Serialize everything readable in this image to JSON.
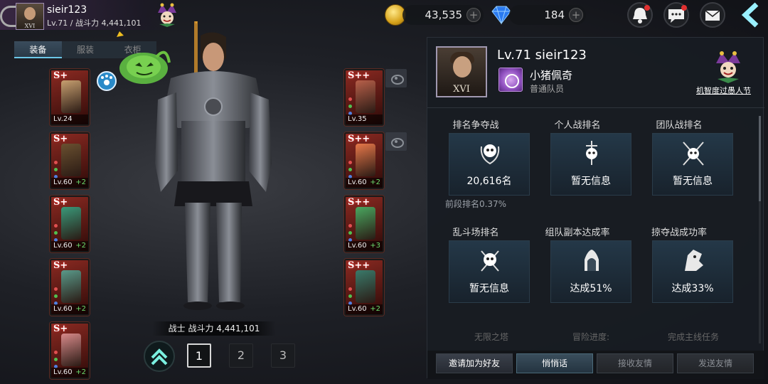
{
  "player": {
    "name": "sieir123",
    "level_line": "Lv.71 / 战斗力 4,441,101",
    "avatar_rank": "XVI"
  },
  "tabs": [
    {
      "label": "装备"
    },
    {
      "label": "服装"
    },
    {
      "label": "衣柜"
    }
  ],
  "active_tab": "装备",
  "left_slots": [
    {
      "grade": "S+",
      "level": "Lv.24",
      "plus": "",
      "art_color": "#c8a070"
    },
    {
      "grade": "S+",
      "level": "Lv.60",
      "plus": "+2",
      "art_color": "#6a5030"
    },
    {
      "grade": "S+",
      "level": "Lv.60",
      "plus": "+2",
      "art_color": "#3a9a7a"
    },
    {
      "grade": "S+",
      "level": "Lv.60",
      "plus": "+2",
      "art_color": "#5a9a8a"
    },
    {
      "grade": "S+",
      "level": "Lv.60",
      "plus": "+2",
      "art_color": "#d88a8a"
    }
  ],
  "right_slots": [
    {
      "grade": "S++",
      "level": "Lv.35",
      "plus": "",
      "art_color": "#b8604a"
    },
    {
      "grade": "S++",
      "level": "Lv.60",
      "plus": "+2",
      "art_color": "#e8784a"
    },
    {
      "grade": "S++",
      "level": "Lv.60",
      "plus": "+3",
      "art_color": "#4aa860"
    },
    {
      "grade": "S++",
      "level": "Lv.60",
      "plus": "+2",
      "art_color": "#3a7a6a"
    }
  ],
  "character": {
    "power_line": "战士 战斗力 4,441,101"
  },
  "pages": [
    "1",
    "2",
    "3"
  ],
  "active_page": "1",
  "currency": {
    "gold": "43,535",
    "gems": "184"
  },
  "profile": {
    "title": "Lv.71 sieir123",
    "guild_name": "小猪佩奇",
    "guild_role": "普通队员",
    "avatar_rank": "XVI",
    "event_title": "机智度过愚人节"
  },
  "stats": [
    {
      "label": "排名争夺战",
      "value": "20,616名",
      "sub": "前段排名0.37%",
      "icon": "skull-wreath-icon"
    },
    {
      "label": "个人战排名",
      "value": "暂无信息",
      "sub": "",
      "icon": "skull-sword-icon"
    },
    {
      "label": "团队战排名",
      "value": "暂无信息",
      "sub": "",
      "icon": "skull-crossed-swords-icon"
    },
    {
      "label": "乱斗场排名",
      "value": "暂无信息",
      "sub": "",
      "icon": "skull-spiked-icon"
    },
    {
      "label": "组队副本达成率",
      "value": "达成51%",
      "sub": "",
      "icon": "crown-altar-icon"
    },
    {
      "label": "掠夺战成功率",
      "value": "达成33%",
      "sub": "",
      "icon": "dragon-head-icon"
    }
  ],
  "more_rows": [
    "无限之塔",
    "冒险进度:",
    "完成主线任务"
  ],
  "actions": [
    {
      "label": "邀请加为好友"
    },
    {
      "label": "悄悄话"
    },
    {
      "label": "接收友情"
    },
    {
      "label": "发送友情"
    }
  ],
  "colors": {
    "accent": "#6cc8e8",
    "equip_red": "#8b2a22",
    "plus_green": "#6ddc6d"
  }
}
